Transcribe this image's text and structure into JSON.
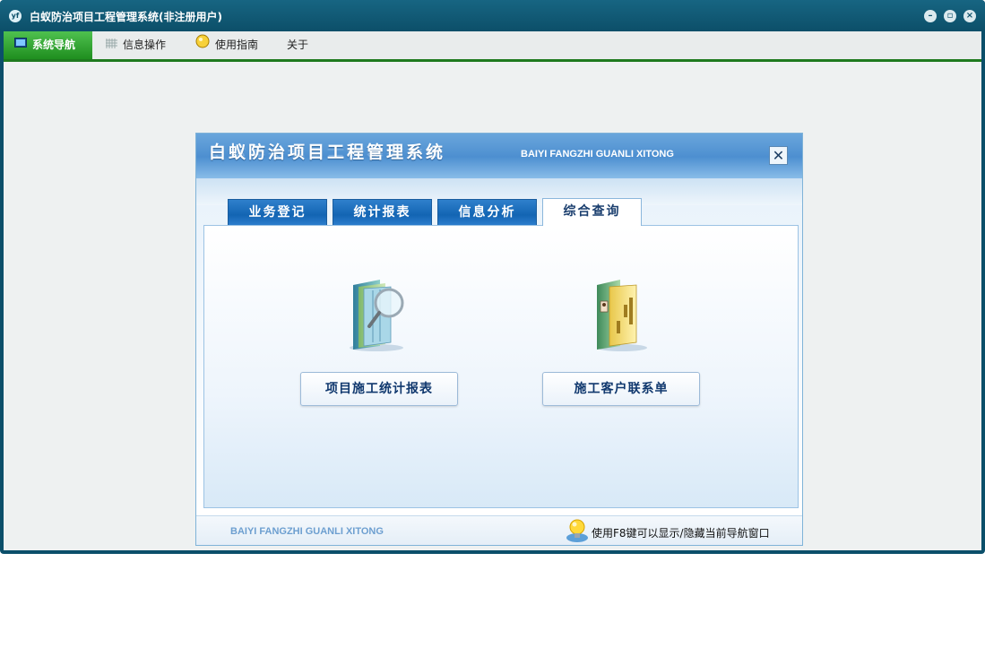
{
  "window": {
    "title": "白蚁防治项目工程管理系统(非注册用户)",
    "app_icon": "yf-logo-icon",
    "controls": [
      "minimize-icon",
      "restore-icon",
      "close-icon"
    ]
  },
  "menubar": {
    "items": [
      {
        "label": "系统导航",
        "icon": "monitor-icon",
        "active": true
      },
      {
        "label": "信息操作",
        "icon": "grid-icon",
        "active": false
      },
      {
        "label": "使用指南",
        "icon": "bulb-icon",
        "active": false
      },
      {
        "label": "关于",
        "icon": "",
        "active": false
      }
    ]
  },
  "dialog": {
    "title": "白蚁防治项目工程管理系统",
    "subtitle": "BAIYI FANGZHI GUANLI XITONG",
    "close_glyph": "✕",
    "tabs": [
      {
        "label": "业务登记",
        "selected": false
      },
      {
        "label": "统计报表",
        "selected": false
      },
      {
        "label": "信息分析",
        "selected": false
      },
      {
        "label": "综合查询",
        "selected": true
      }
    ],
    "buttons": [
      {
        "label": "项目施工统计报表",
        "icon": "folder-search-icon"
      },
      {
        "label": "施工客户联系单",
        "icon": "contact-folder-icon"
      }
    ],
    "footer": {
      "brand": "BAIYI FANGZHI GUANLI XITONG",
      "tip": "使用F8键可以显示/隐藏当前导航窗口",
      "tip_icon": "lightbulb-icon"
    }
  },
  "colors": {
    "window_frame": "#0b4f6a",
    "menu_active": "#2c9a2c",
    "tab_blue": "#1a6cbb",
    "dialog_header": "#5b98d6"
  }
}
